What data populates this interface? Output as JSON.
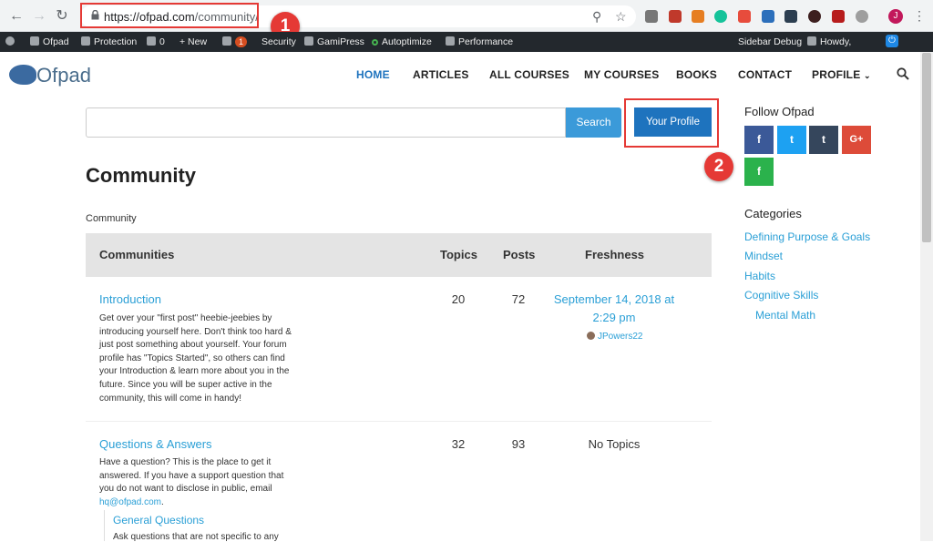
{
  "browser": {
    "url_host": "https://ofpad.com",
    "url_path": "/community/",
    "annotation_1": "1",
    "annotation_2": "2",
    "profile_initial": "J"
  },
  "adminbar": {
    "site": "Ofpad",
    "protection": "Protection",
    "comments_count": "0",
    "new": "+ New",
    "updates_count": "1",
    "security": "Security",
    "gamipress": "GamiPress",
    "autoptimize": "Autoptimize",
    "performance": "Performance",
    "sidebar_debug": "Sidebar Debug",
    "howdy": "Howdy,"
  },
  "header": {
    "logo": "Ofpad",
    "nav": [
      "HOME",
      "ARTICLES",
      "ALL COURSES",
      "MY COURSES",
      "BOOKS",
      "CONTACT",
      "PROFILE"
    ]
  },
  "main": {
    "search_button": "Search",
    "profile_button": "Your Profile",
    "page_title": "Community",
    "breadcrumb": "Community",
    "columns": [
      "Communities",
      "Topics",
      "Posts",
      "Freshness"
    ],
    "forums": [
      {
        "title": "Introduction",
        "desc": "Get over your \"first post\" heebie-jeebies by introducing yourself here. Don't think too hard & just post something about yourself. Your forum profile has \"Topics Started\", so others can find your Introduction & learn more about you in the future. Since you will be super active in the community, this will come in handy!",
        "topics": "20",
        "posts": "72",
        "freshness": "September 14, 2018 at 2:29 pm",
        "author": "JPowers22"
      },
      {
        "title": "Questions & Answers",
        "desc": "Have a question? This is the place to get it answered. If you have a support question that you do not want to disclose in public, email",
        "email": "hq@ofpad.com",
        "email_suffix": ".",
        "topics": "32",
        "posts": "93",
        "freshness": "No Topics",
        "subforum_title": "General Questions",
        "subforum_desc": "Ask questions that are not specific to any"
      }
    ]
  },
  "sidebar": {
    "follow_heading": "Follow Ofpad",
    "social": [
      {
        "icon": "facebook-icon",
        "glyph": "f",
        "color": "#3b5998"
      },
      {
        "icon": "twitter-icon",
        "glyph": "t",
        "color": "#1da1f2"
      },
      {
        "icon": "tumblr-icon",
        "glyph": "t",
        "color": "#35465c"
      },
      {
        "icon": "google-plus-icon",
        "glyph": "G+",
        "color": "#dd4b39"
      },
      {
        "icon": "feedly-icon",
        "glyph": "f",
        "color": "#2bb24c"
      }
    ],
    "categories_heading": "Categories",
    "categories": [
      "Defining Purpose & Goals",
      "Mindset",
      "Habits",
      "Cognitive Skills",
      "Mental Math"
    ]
  }
}
